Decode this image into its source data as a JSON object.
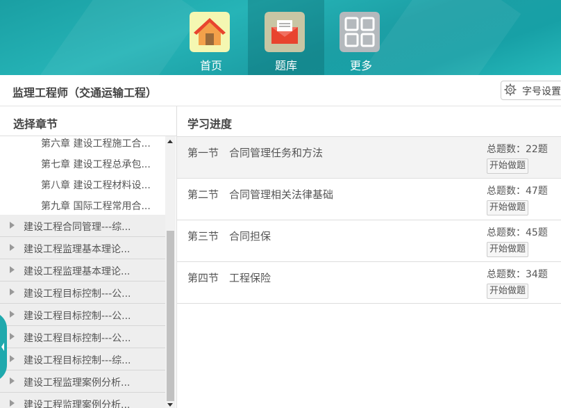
{
  "nav": {
    "items": [
      {
        "label": "首页",
        "icon": "home-icon",
        "active": false
      },
      {
        "label": "题库",
        "icon": "question-bank-icon",
        "active": true
      },
      {
        "label": "更多",
        "icon": "grid-icon",
        "active": false
      }
    ]
  },
  "header": {
    "title": "监理工程师（交通运输工程）",
    "font_setting_label": "字号设置"
  },
  "left_panel": {
    "title": "选择章节",
    "sub_items": [
      "第六章 建设工程施工合...",
      "第七章 建设工程总承包...",
      "第八章 建设工程材料设...",
      "第九章 国际工程常用合..."
    ],
    "categories": [
      "建设工程合同管理---综...",
      "建设工程监理基本理论...",
      "建设工程监理基本理论...",
      "建设工程目标控制---公...",
      "建设工程目标控制---公...",
      "建设工程目标控制---公...",
      "建设工程目标控制---综...",
      "建设工程监理案例分析...",
      "建设工程监理案例分析..."
    ]
  },
  "right_panel": {
    "title": "学习进度",
    "sections": [
      {
        "name": "第一节　合同管理任务和方法",
        "count": "总题数：22题",
        "action": "开始做题"
      },
      {
        "name": "第二节　合同管理相关法律基础",
        "count": "总题数：47题",
        "action": "开始做题"
      },
      {
        "name": "第三节　合同担保",
        "count": "总题数：45题",
        "action": "开始做题"
      },
      {
        "name": "第四节　工程保险",
        "count": "总题数：34题",
        "action": "开始做题"
      }
    ]
  },
  "colors": {
    "accent": "#1fa9ad",
    "teal_dark": "#178f95"
  }
}
